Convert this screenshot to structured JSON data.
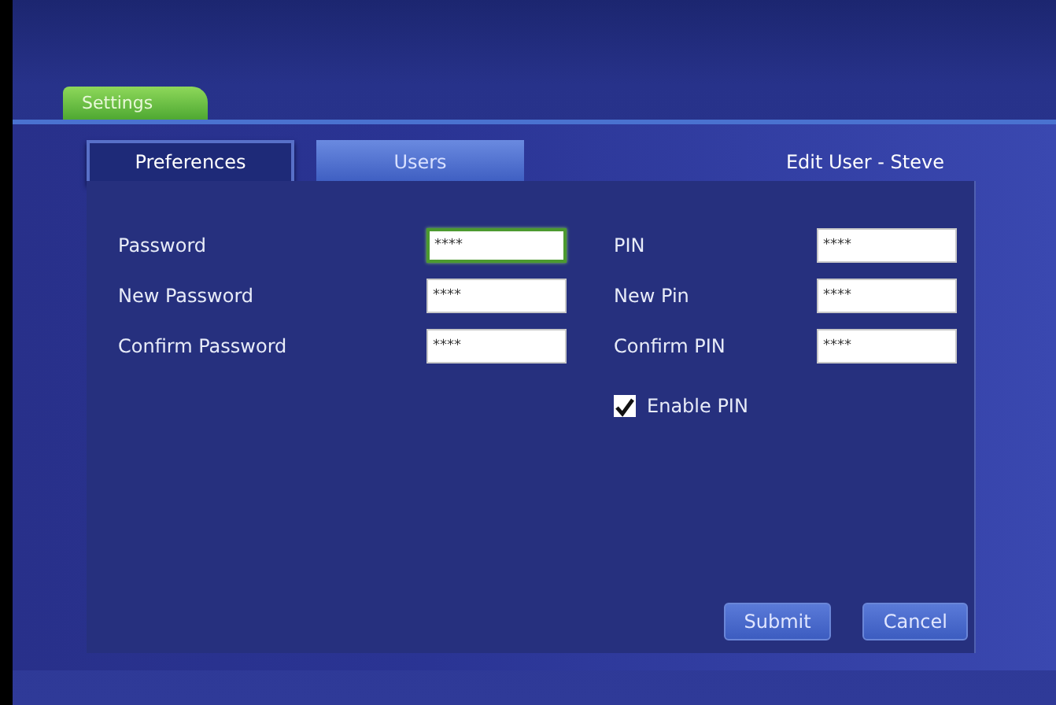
{
  "app_tab": {
    "label": "Settings",
    "selected": true
  },
  "tabs": [
    {
      "label": "Preferences",
      "selected": true
    },
    {
      "label": "Users",
      "selected": false
    }
  ],
  "heading": "Edit User - Steve",
  "columns": [
    {
      "fields": [
        {
          "label": "Password",
          "value": "****",
          "focused": true
        },
        {
          "label": "New Password",
          "value": "****",
          "focused": false
        },
        {
          "label": "Confirm Password",
          "value": "****",
          "focused": false
        }
      ]
    },
    {
      "fields": [
        {
          "label": "PIN",
          "value": "****",
          "focused": false
        },
        {
          "label": "New Pin",
          "value": "****",
          "focused": false
        },
        {
          "label": "Confirm PIN",
          "value": "****",
          "focused": false
        }
      ],
      "checkbox": {
        "label": "Enable PIN",
        "checked": true
      }
    }
  ],
  "buttons": [
    "Submit",
    "Cancel"
  ]
}
